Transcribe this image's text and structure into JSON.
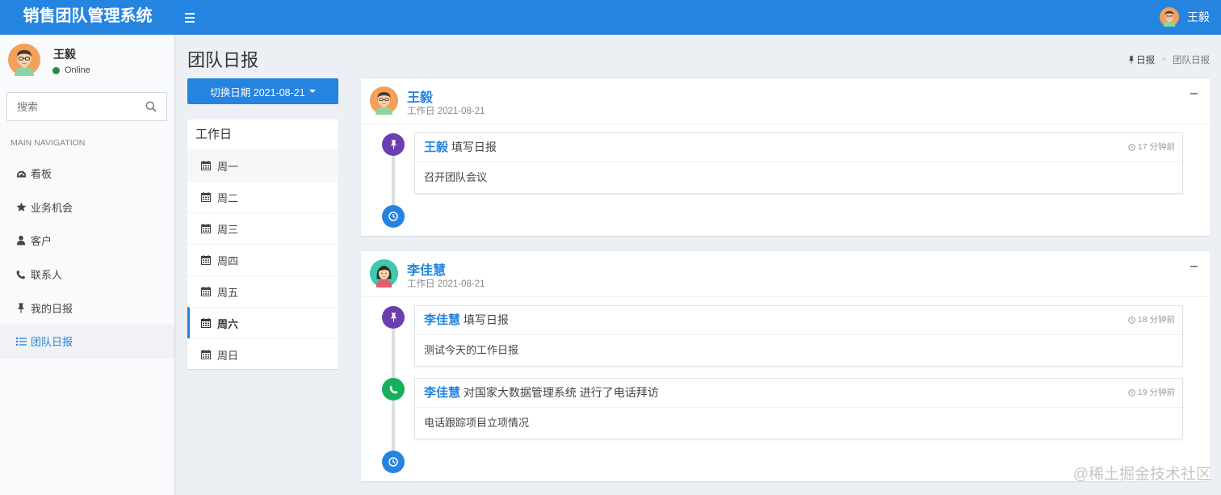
{
  "header": {
    "logo": "销售团队管理系统",
    "user_name": "王毅"
  },
  "sidebar": {
    "user_name": "王毅",
    "status": "Online",
    "search_placeholder": "搜索",
    "nav_header": "MAIN NAVIGATION",
    "items": [
      {
        "label": "看板",
        "icon": "dashboard-icon"
      },
      {
        "label": "业务机会",
        "icon": "star-icon"
      },
      {
        "label": "客户",
        "icon": "user-icon"
      },
      {
        "label": "联系人",
        "icon": "phone-icon"
      },
      {
        "label": "我的日报",
        "icon": "pin-icon"
      },
      {
        "label": "团队日报",
        "icon": "list-icon",
        "active": true
      }
    ]
  },
  "content": {
    "title": "团队日报",
    "breadcrumb": {
      "home": "日报",
      "current": "团队日报"
    },
    "date_button": "切换日期 2021-08-21",
    "days_title": "工作日",
    "days": [
      "周一",
      "周二",
      "周三",
      "周四",
      "周五",
      "周六",
      "周日"
    ],
    "active_day": "周六",
    "reports": [
      {
        "name": "王毅",
        "subtitle": "工作日 2021-08-21",
        "entries": [
          {
            "who": "王毅",
            "action": "填写日报",
            "time": "17 分钟前",
            "body": "召开团队会议",
            "icon": "pin-icon"
          }
        ]
      },
      {
        "name": "李佳慧",
        "subtitle": "工作日 2021-08-21",
        "entries": [
          {
            "who": "李佳慧",
            "action": "填写日报",
            "time": "18 分钟前",
            "body": "测试今天的工作日报",
            "icon": "pin-icon"
          },
          {
            "who": "李佳慧",
            "action": "对国家大数据管理系统 进行了电话拜访",
            "time": "19 分钟前",
            "body": "电话跟踪项目立项情况",
            "icon": "phone-icon"
          }
        ]
      }
    ]
  },
  "watermark": "@稀土掘金技术社区",
  "colors": {
    "primary": "#2484e0",
    "purple": "#6a3fb0",
    "green": "#17b05a",
    "background": "#ecf0f5"
  }
}
